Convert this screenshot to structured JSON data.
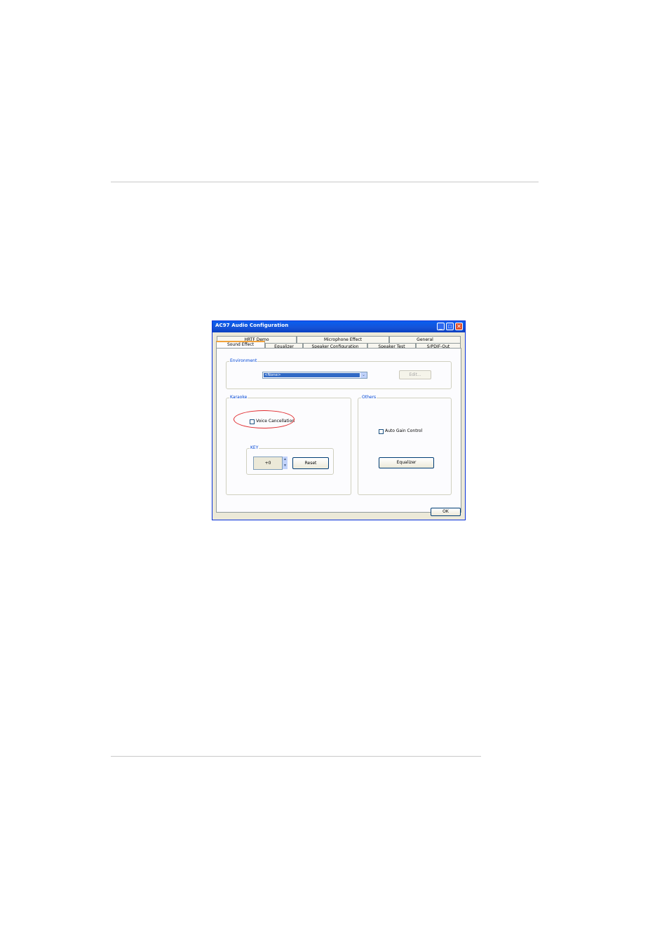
{
  "window": {
    "title": "AC97 Audio Configuration",
    "minimize_glyph": "_",
    "maximize_glyph": "□",
    "close_glyph": "✕"
  },
  "tabs": {
    "row_back": [
      "HRTF Demo",
      "Microphone Effect",
      "General"
    ],
    "row_front": [
      "Sound Effect",
      "Equalizer",
      "Speaker Configuration",
      "Speaker Test",
      "S/PDIF-Out"
    ],
    "active": "Sound Effect"
  },
  "environment": {
    "legend": "Environment",
    "selected": "<None>",
    "arrow_glyph": "⌄",
    "edit_button": "Edit..."
  },
  "karaoke": {
    "legend": "Karaoke",
    "voice_cancellation_label": "Voice Cancellation",
    "voice_cancellation_checked": false,
    "key_legend": "KEY",
    "key_value": "+0",
    "spin_up": "▲",
    "spin_down": "▼",
    "reset_button": "Reset"
  },
  "others": {
    "legend": "Others",
    "auto_gain_label": "Auto Gain Control",
    "auto_gain_checked": false,
    "equalizer_button": "Equalizer"
  },
  "footer": {
    "ok_button": "OK"
  },
  "colors": {
    "titlebar": "#0a5ff0",
    "highlight": "#e0292d",
    "group_legend": "#0046d5"
  }
}
